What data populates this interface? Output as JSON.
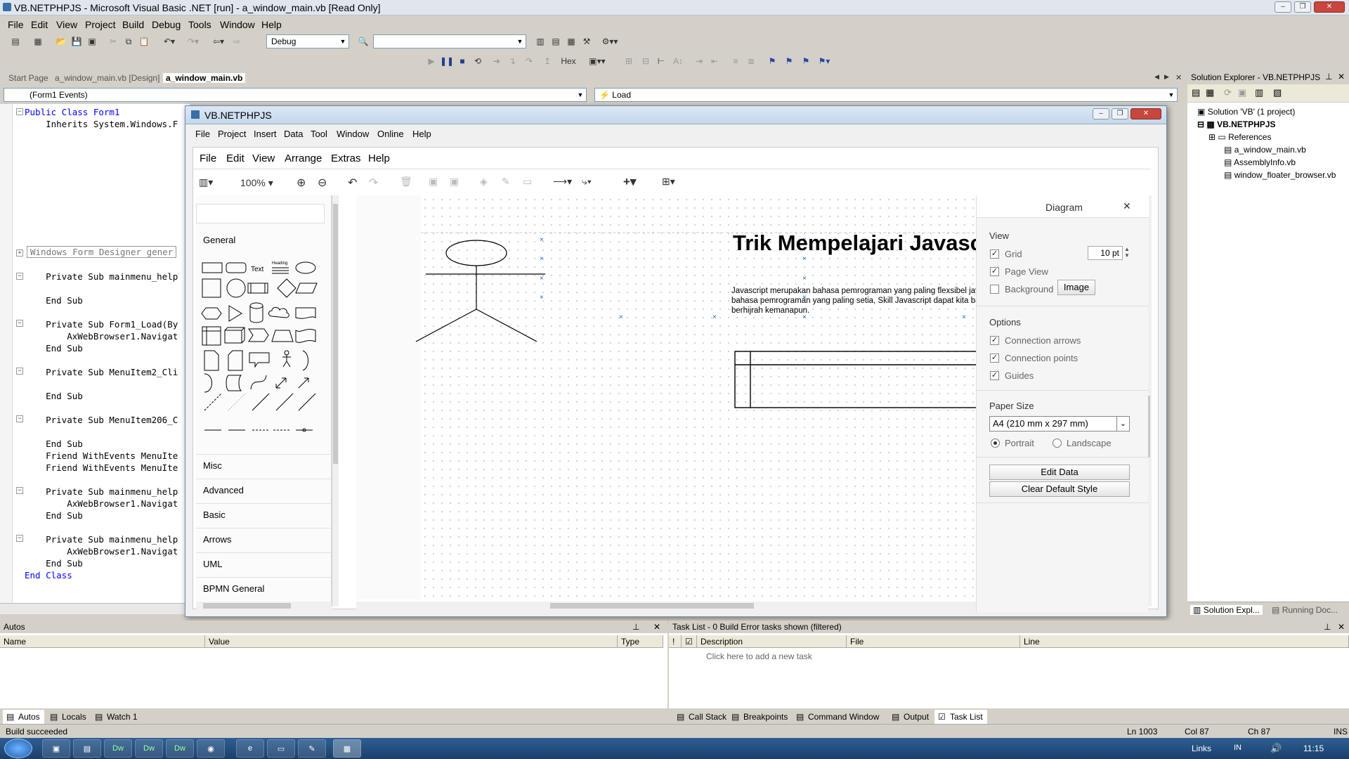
{
  "window": {
    "title": "VB.NETPHPJS - Microsoft Visual Basic .NET [run] - a_window_main.vb [Read Only]"
  },
  "ide_menu": [
    "File",
    "Edit",
    "View",
    "Project",
    "Build",
    "Debug",
    "Tools",
    "Window",
    "Help"
  ],
  "toolbar": {
    "config": "Debug",
    "hex_label": "Hex"
  },
  "doc_tabs": {
    "start_page": "Start Page",
    "design_tab": "a_window_main.vb [Design]",
    "active_tab": "a_window_main.vb"
  },
  "code_nav": {
    "class_combo": "(Form1 Events)",
    "method_combo": "Load"
  },
  "code_lines": [
    "Public Class Form1",
    "    Inherits System.Windows.F",
    "Windows Form Designer gener",
    "    Private Sub mainmenu_help",
    "    End Sub",
    "    Private Sub Form1_Load(By",
    "        AxWebBrowser1.Navigat",
    "    End Sub",
    "    Private Sub MenuItem2_Cli",
    "    End Sub",
    "    Private Sub MenuItem206_C",
    "    End Sub",
    "    Friend WithEvents MenuIte",
    "    Friend WithEvents MenuIte",
    "    Private Sub mainmenu_help",
    "        AxWebBrowser1.Navigat",
    "    End Sub",
    "    Private Sub mainmenu_help",
    "        AxWebBrowser1.Navigat",
    "    End Sub",
    "End Class"
  ],
  "floater": {
    "title": "VB.NETPHPJS",
    "menu": [
      "File",
      "Project",
      "Insert",
      "Data",
      "Tool",
      "Window",
      "Online",
      "Help"
    ]
  },
  "diagram_app": {
    "menu": [
      "File",
      "Edit",
      "View",
      "Arrange",
      "Extras",
      "Help"
    ],
    "zoom": "100%",
    "library": {
      "search_placeholder": "",
      "general": "General",
      "text_shape": "Text",
      "heading_shape": "Heading",
      "categories": [
        "Misc",
        "Advanced",
        "Basic",
        "Arrows",
        "UML",
        "BPMN General"
      ]
    },
    "canvas": {
      "heading": "Trik Mempelajari Javascript",
      "body_text": "Javascript merupakan bahasa pemrograman yang paling flexsibel javascript juga bahasa pemrograman yang paling setia, Skill Javascript dapat kita bawa untuk berhijrah kemanapun."
    },
    "format_panel": {
      "title": "Diagram",
      "view_section": "View",
      "grid": "Grid",
      "grid_size": "10 pt",
      "grid_checked": true,
      "page_view": "Page View",
      "page_view_checked": true,
      "background": "Background",
      "background_checked": false,
      "image_button": "Image",
      "options_section": "Options",
      "connection_arrows": "Connection arrows",
      "connection_points": "Connection points",
      "guides": "Guides",
      "paper_size_section": "Paper Size",
      "paper_size": "A4 (210 mm x 297 mm)",
      "portrait": "Portrait",
      "landscape": "Landscape",
      "orientation": "Portrait",
      "edit_data": "Edit Data",
      "clear_default_style": "Clear Default Style"
    }
  },
  "solution_explorer": {
    "title": "Solution Explorer - VB.NETPHPJS",
    "solution": "Solution 'VB' (1 project)",
    "project": "VB.NETPHPJS",
    "items": [
      "References",
      "a_window_main.vb",
      "AssemblyInfo.vb",
      "window_floater_browser.vb"
    ],
    "bottom_tabs": [
      "Solution Expl...",
      "Running Doc..."
    ]
  },
  "autos": {
    "title": "Autos",
    "columns": [
      "Name",
      "Value",
      "Type"
    ],
    "tabs": [
      "Autos",
      "Locals",
      "Watch 1"
    ]
  },
  "task_list": {
    "title": "Task List - 0 Build Error tasks shown (filtered)",
    "columns": [
      "!",
      "Description",
      "File",
      "Line"
    ],
    "placeholder_row": "Click here to add a new task",
    "tabs": [
      "Call Stack",
      "Breakpoints",
      "Command Window",
      "Output",
      "Task List"
    ]
  },
  "status": {
    "message": "Build succeeded",
    "ln": "Ln 1003",
    "col": "Col 87",
    "ch": "Ch 87",
    "mode": "INS"
  },
  "taskbar": {
    "links": "Links",
    "lang": "IN",
    "time": "11:15"
  }
}
